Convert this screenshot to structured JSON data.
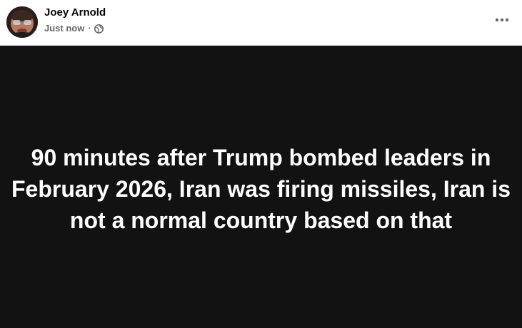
{
  "post": {
    "author": "Joey Arnold",
    "timestamp": "Just now",
    "separator": "·",
    "privacy_icon": "globe-icon",
    "menu_icon": "more-horizontal-icon",
    "body_text": "90 minutes after Trump bombed leaders in February 2026, Iran was firing missiles, Iran is not a normal country based on that",
    "body_background": "#121212",
    "body_text_color": "#ffffff"
  }
}
